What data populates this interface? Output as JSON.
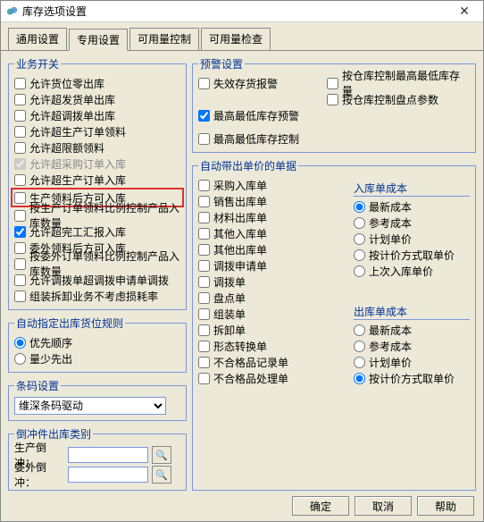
{
  "window": {
    "title": "库存选项设置"
  },
  "tabs": [
    "通用设置",
    "专用设置",
    "可用量控制",
    "可用量检查"
  ],
  "activeTab": 1,
  "bizSwitch": {
    "legend": "业务开关",
    "items": [
      {
        "label": "允许货位零出库",
        "checked": false
      },
      {
        "label": "允许超发货单出库",
        "checked": false
      },
      {
        "label": "允许超调拨单出库",
        "checked": false
      },
      {
        "label": "允许超生产订单领料",
        "checked": false
      },
      {
        "label": "允许超限额领料",
        "checked": false
      },
      {
        "label": "允许超采购订单入库",
        "checked": true,
        "disabled": true
      },
      {
        "label": "允许超生产订单入库",
        "checked": false
      },
      {
        "label": "生产领料后方可入库",
        "checked": false,
        "highlight": true
      },
      {
        "label": "按生产订单领料比例控制产品入库数量",
        "checked": false
      },
      {
        "label": "允许超完工汇报入库",
        "checked": true
      },
      {
        "label": "委外领料后方可入库",
        "checked": false
      },
      {
        "label": "按委外订单领料比例控制产品入库数量",
        "checked": false
      },
      {
        "label": "允许调拨单超调拨申请单调拨",
        "checked": false
      },
      {
        "label": "组装拆卸业务不考虑损耗率",
        "checked": false
      }
    ]
  },
  "autoLocRule": {
    "legend": "自动指定出库货位规则",
    "options": [
      "优先顺序",
      "量少先出"
    ],
    "selected": 0
  },
  "barcode": {
    "legend": "条码设置",
    "options": [
      "维深条码驱动"
    ],
    "selected": "维深条码驱动"
  },
  "offset": {
    "legend": "倒冲件出库类别",
    "rows": [
      {
        "label": "生产倒冲：",
        "value": ""
      },
      {
        "label": "委外倒冲：",
        "value": ""
      }
    ],
    "searchIcon": "🔍"
  },
  "warning": {
    "legend": "预警设置",
    "left": [
      {
        "label": "失效存货报警",
        "checked": false
      },
      {
        "label": "最高最低库存预警",
        "checked": true
      },
      {
        "label": "最高最低库存控制",
        "checked": false
      }
    ],
    "right": [
      {
        "label": "按仓库控制最高最低库存量",
        "checked": false
      },
      {
        "label": "按仓库控制盘点参数",
        "checked": false
      }
    ]
  },
  "autoPrice": {
    "legend": "自动带出单价的单据",
    "docs": [
      {
        "label": "采购入库单",
        "checked": false
      },
      {
        "label": "销售出库单",
        "checked": false
      },
      {
        "label": "材料出库单",
        "checked": false
      },
      {
        "label": "其他入库单",
        "checked": false
      },
      {
        "label": "其他出库单",
        "checked": false
      },
      {
        "label": "调拨申请单",
        "checked": false
      },
      {
        "label": "调拨单",
        "checked": false
      },
      {
        "label": "盘点单",
        "checked": false
      },
      {
        "label": "组装单",
        "checked": false
      },
      {
        "label": "拆卸单",
        "checked": false
      },
      {
        "label": "形态转换单",
        "checked": false
      },
      {
        "label": "不合格品记录单",
        "checked": false
      },
      {
        "label": "不合格品处理单",
        "checked": false
      }
    ],
    "inCost": {
      "legend": "入库单成本",
      "options": [
        "最新成本",
        "参考成本",
        "计划单价",
        "按计价方式取单价",
        "上次入库单价"
      ],
      "selected": 0
    },
    "outCost": {
      "legend": "出库单成本",
      "options": [
        "最新成本",
        "参考成本",
        "计划单价",
        "按计价方式取单价"
      ],
      "selected": 3
    }
  },
  "footer": {
    "ok": "确定",
    "cancel": "取消",
    "help": "帮助"
  }
}
